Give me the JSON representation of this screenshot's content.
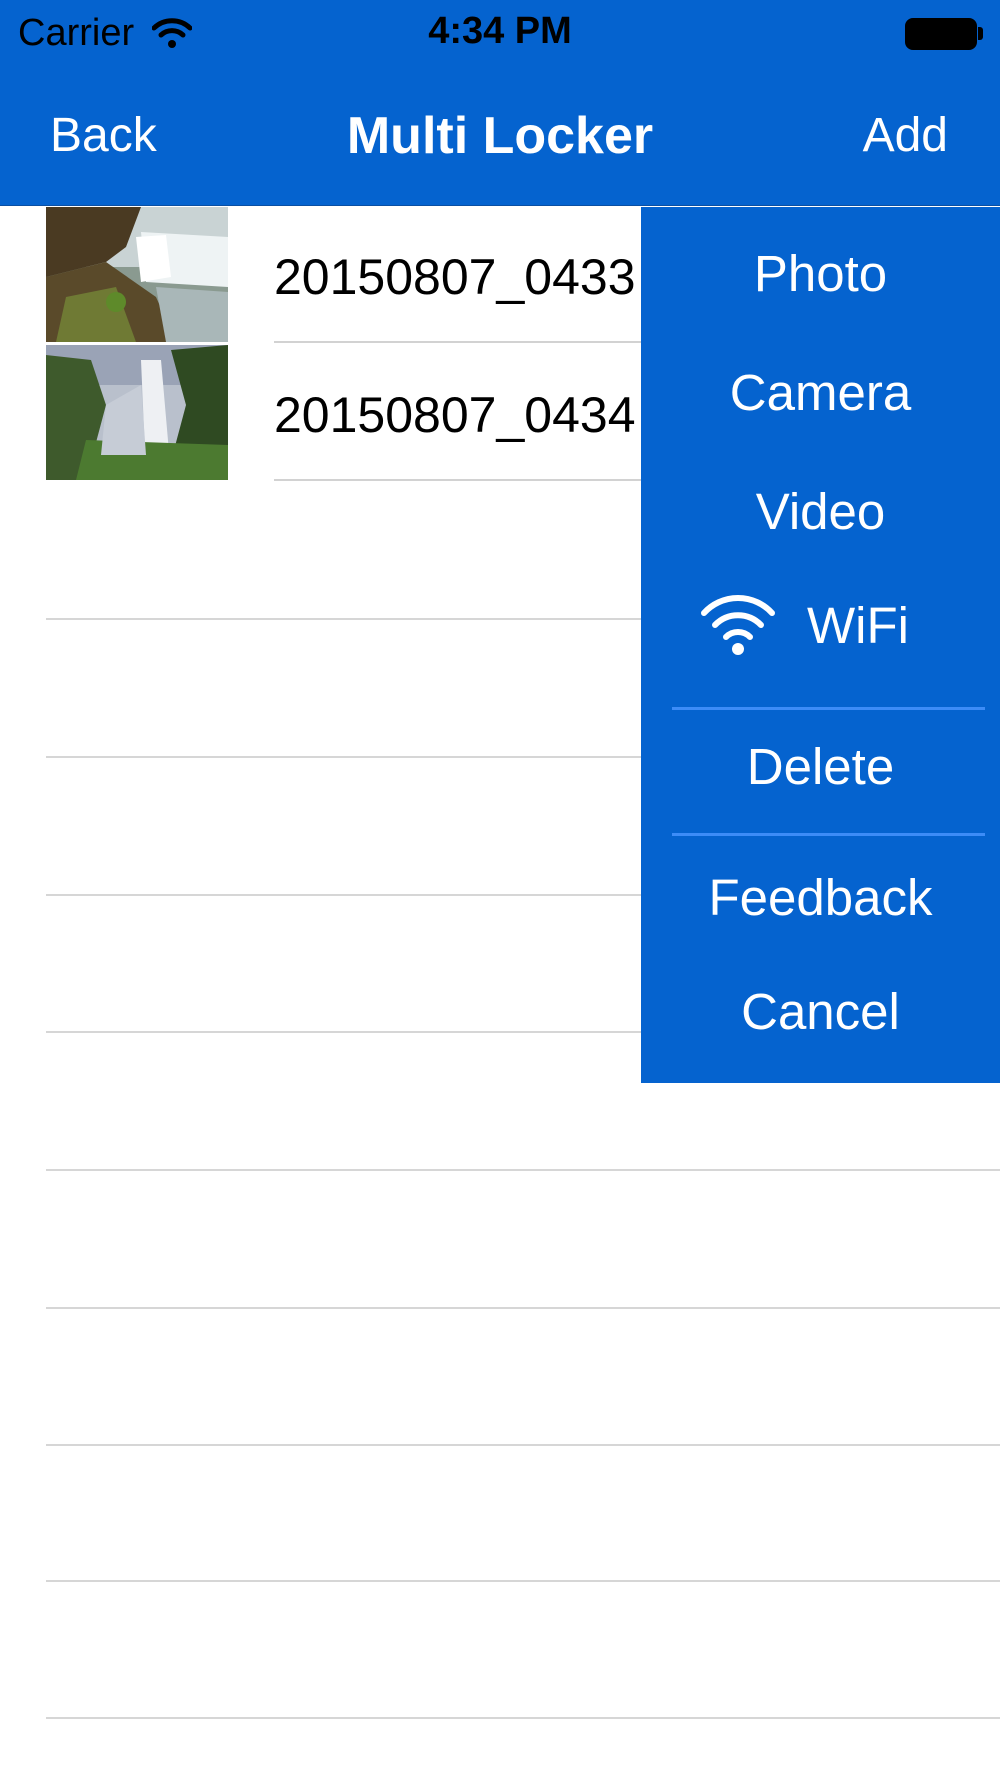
{
  "status_bar": {
    "carrier": "Carrier",
    "time": "4:34 PM"
  },
  "nav": {
    "back_label": "Back",
    "title": "Multi Locker",
    "add_label": "Add"
  },
  "files": [
    {
      "name": "20150807_0433"
    },
    {
      "name": "20150807_0434"
    }
  ],
  "menu": {
    "photo": "Photo",
    "camera": "Camera",
    "video": "Video",
    "wifi": "WiFi",
    "delete": "Delete",
    "feedback": "Feedback",
    "cancel": "Cancel"
  },
  "colors": {
    "accent": "#0563cf",
    "divider": "#3d8cf7",
    "separator": "#d6d6d6"
  },
  "icons": {
    "status_wifi": "wifi-icon",
    "battery": "battery-icon",
    "menu_wifi": "wifi-icon"
  }
}
